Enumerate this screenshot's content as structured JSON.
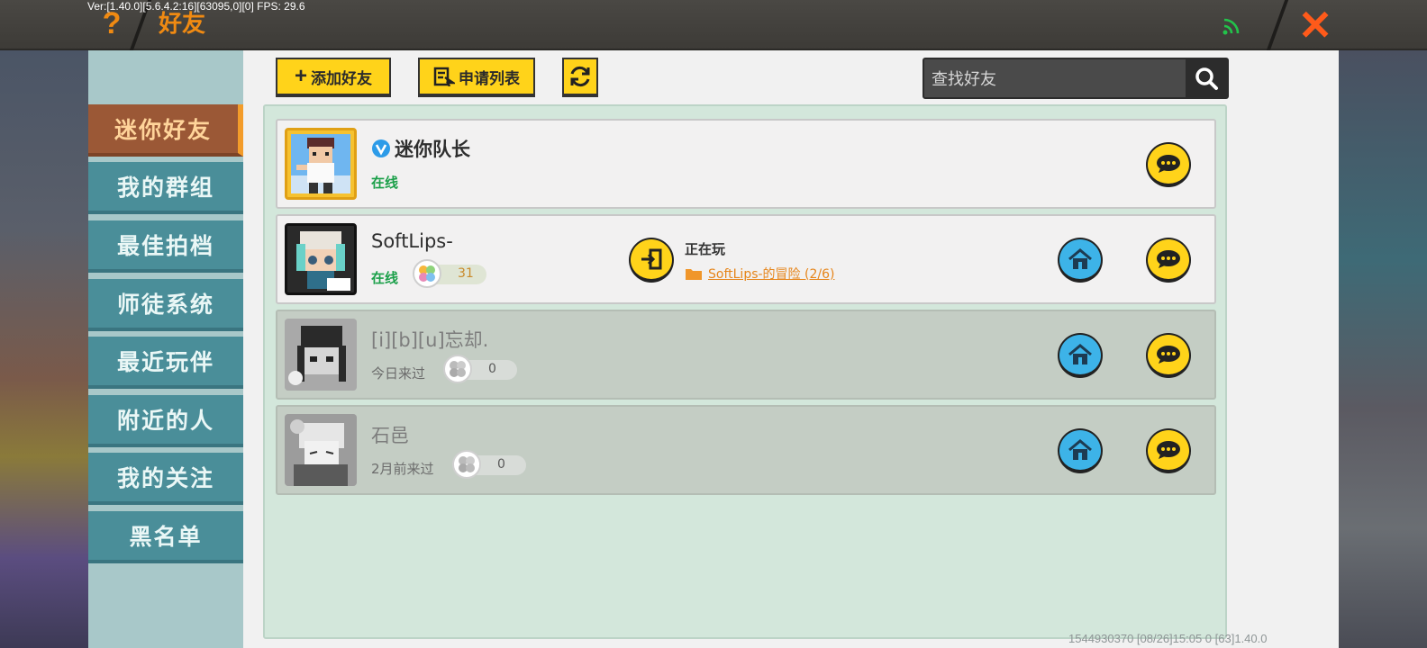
{
  "debug": {
    "text": "Ver:[1.40.0][5.6.4.2:16][63095,0][0] FPS: 29.6"
  },
  "header": {
    "title": "好友",
    "help_symbol": "?",
    "close_symbol": "✕"
  },
  "sidebar": {
    "items": [
      {
        "label": "迷你好友",
        "active": true
      },
      {
        "label": "我的群组"
      },
      {
        "label": "最佳拍档"
      },
      {
        "label": "师徒系统"
      },
      {
        "label": "最近玩伴"
      },
      {
        "label": "附近的人"
      },
      {
        "label": "我的关注"
      },
      {
        "label": "黑名单"
      }
    ]
  },
  "toolbar": {
    "add_friend": "添加好友",
    "apply_list": "申请列表",
    "search_placeholder": "查找好友"
  },
  "friends": [
    {
      "name": "迷你队长",
      "status": "在线",
      "verified": true
    },
    {
      "name": "SoftLips-",
      "status": "在线",
      "badge": "31",
      "playing_label": "正在玩",
      "playing_world": "SoftLips-的冒险 (2/6)"
    },
    {
      "name": "[i][b][u]忘却.",
      "status": "今日来过",
      "badge": "0"
    },
    {
      "name": "石邑",
      "status": "2月前来过",
      "badge": "0"
    }
  ],
  "footer": {
    "text": "1544930370    [08/26]15:05 0  [63]1.40.0"
  },
  "colors": {
    "accent_orange": "#f08a12",
    "button_yellow": "#ffd31a",
    "tab_teal": "#4a8e99",
    "tab_active": "#9b5836",
    "online_green": "#1ca04a",
    "home_blue": "#3db3e8"
  },
  "icons": [
    "help-icon",
    "wifi-icon",
    "close-icon",
    "plus-icon",
    "list-icon",
    "refresh-icon",
    "search-icon",
    "verified-icon",
    "join-icon",
    "home-icon",
    "chat-icon",
    "folder-icon",
    "badge-icon"
  ]
}
